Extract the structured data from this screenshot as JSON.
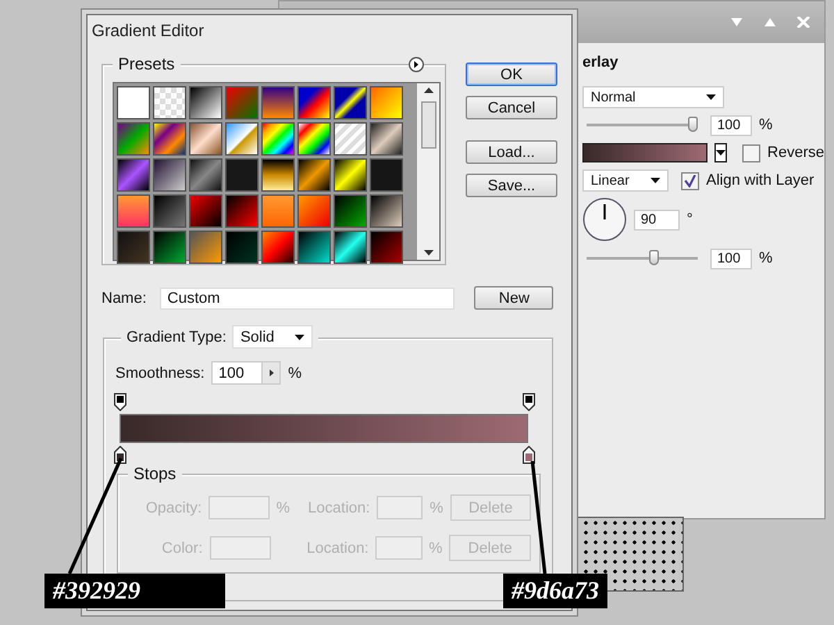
{
  "background_window": {
    "group_title": "erlay",
    "blend_mode": "Normal",
    "opacity": {
      "level": 0.95,
      "value": "100",
      "unit": "%"
    },
    "reverse": {
      "label": "Reverse",
      "checked": false
    },
    "style": "Linear",
    "align": {
      "label": "Align with Layer",
      "checked": true
    },
    "angle": {
      "value": "90",
      "unit": "°"
    },
    "scale": {
      "level": 0.6,
      "value": "100",
      "unit": "%"
    }
  },
  "dialog": {
    "title": "Gradient Editor",
    "presets_title": "Presets",
    "buttons": [
      {
        "label": "OK",
        "default": true
      },
      {
        "label": "Cancel",
        "default": false
      },
      {
        "label": "Load...",
        "default": false
      },
      {
        "label": "Save...",
        "default": false
      }
    ],
    "name": {
      "label": "Name:",
      "value": "Custom",
      "button": "New"
    },
    "gradient_type": {
      "label": "Gradient Type:",
      "value": "Solid"
    },
    "smoothness": {
      "label": "Smoothness:",
      "value": "100",
      "unit": "%"
    },
    "color_stops": [
      {
        "color": "#392929"
      },
      {
        "color": "#9d6a73"
      }
    ],
    "stops": {
      "title": "Stops",
      "disabled": true,
      "rows": [
        {
          "label": "Opacity:",
          "unit": "%",
          "location_label": "Location:",
          "location_unit": "%",
          "button": "Delete"
        },
        {
          "label": "Color:",
          "unit": "",
          "location_label": "Location:",
          "location_unit": "%",
          "button": "Delete"
        }
      ]
    }
  },
  "annotations": [
    {
      "text": "#392929"
    },
    {
      "text": "#9d6a73"
    }
  ]
}
